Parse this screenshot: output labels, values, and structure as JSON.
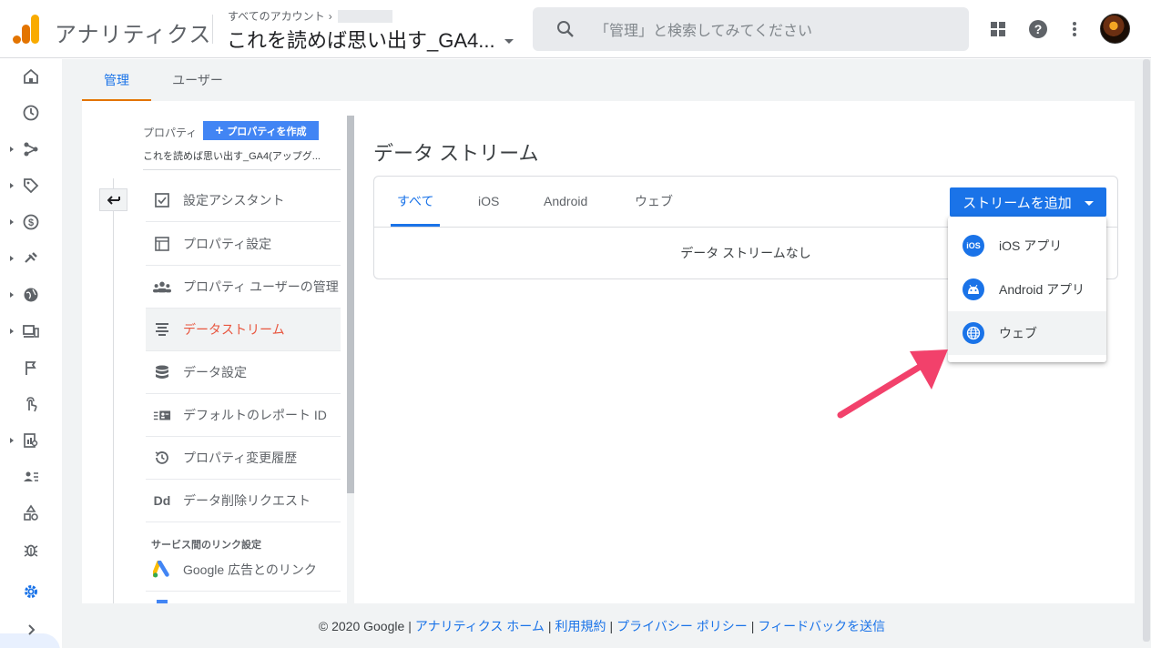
{
  "header": {
    "app_title": "アナリティクス",
    "account_crumb": "すべてのアカウント",
    "property_name": "これを読めば思い出す_GA4...",
    "search_placeholder": "「管理」と検索してみてください"
  },
  "top_tabs": [
    {
      "label": "管理",
      "active": true
    },
    {
      "label": "ユーザー",
      "active": false
    }
  ],
  "property_column": {
    "label": "プロパティ",
    "create_button": "プロパティを作成",
    "selected_property": "これを読めば思い出す_GA4(アップグ...",
    "menu": [
      {
        "label": "設定アシスタント",
        "icon": "checkbox-icon",
        "active": false
      },
      {
        "label": "プロパティ設定",
        "icon": "window-icon",
        "active": false
      },
      {
        "label": "プロパティ ユーザーの管理",
        "icon": "people-icon",
        "active": false
      },
      {
        "label": "データストリーム",
        "icon": "streams-icon",
        "active": true
      },
      {
        "label": "データ設定",
        "icon": "database-icon",
        "active": false
      },
      {
        "label": "デフォルトのレポート ID",
        "icon": "id-card-icon",
        "active": false
      },
      {
        "label": "プロパティ変更履歴",
        "icon": "history-icon",
        "active": false
      },
      {
        "label": "データ削除リクエスト",
        "icon": "dd-icon",
        "active": false
      }
    ],
    "section_heading": "サービス間のリンク設定",
    "link_items": [
      {
        "label": "Google 広告とのリンク",
        "icon": "google-ads-icon"
      }
    ]
  },
  "content": {
    "title": "データ ストリーム",
    "tabs": [
      {
        "label": "すべて",
        "active": true
      },
      {
        "label": "iOS",
        "active": false
      },
      {
        "label": "Android",
        "active": false
      },
      {
        "label": "ウェブ",
        "active": false
      }
    ],
    "empty_message": "データ ストリームなし",
    "add_button": "ストリームを追加",
    "dropdown": [
      {
        "label": "iOS アプリ",
        "icon": "ios-icon",
        "badge": "iOS"
      },
      {
        "label": "Android アプリ",
        "icon": "android-icon",
        "badge": ""
      },
      {
        "label": "ウェブ",
        "icon": "globe-icon",
        "badge": "",
        "highlighted": true
      }
    ]
  },
  "footer": {
    "copyright": "© 2020 Google",
    "links": [
      "アナリティクス ホーム",
      "利用規約",
      "プライバシー ポリシー",
      "フィードバックを送信"
    ],
    "separator": "|"
  },
  "colors": {
    "accent": "#1a73e8",
    "active_menu": "#e8553e",
    "tab_indicator_orange": "#e37400",
    "annotation_arrow": "#f2416b"
  }
}
